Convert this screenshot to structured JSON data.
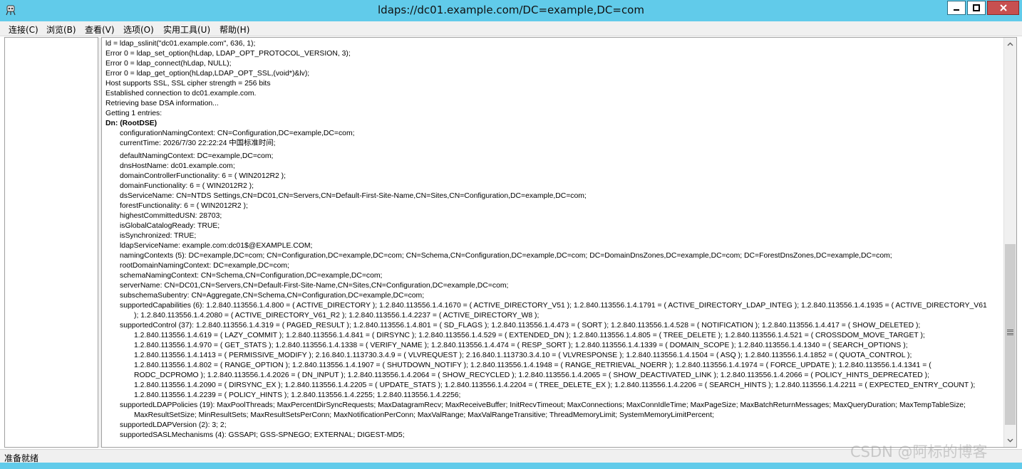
{
  "window": {
    "title": "ldaps://dc01.example.com/DC=example,DC=com",
    "icon": "ldp-app-icon"
  },
  "menu": [
    "连接(C)",
    "浏览(B)",
    "查看(V)",
    "选项(O)",
    "实用工具(U)",
    "帮助(H)"
  ],
  "log": {
    "lines": [
      "ld = ldap_sslinit(\"dc01.example.com\", 636, 1);",
      "Error 0 = ldap_set_option(hLdap, LDAP_OPT_PROTOCOL_VERSION, 3);",
      "Error 0 = ldap_connect(hLdap, NULL);",
      "Error 0 = ldap_get_option(hLdap,LDAP_OPT_SSL,(void*)&lv);",
      "Host supports SSL, SSL cipher strength = 256 bits",
      "Established connection to dc01.example.com.",
      "Retrieving base DSA information...",
      "Getting 1 entries:",
      "Dn: (RootDSE)",
      "configurationNamingContext: CN=Configuration,DC=example,DC=com;",
      "currentTime: 2026/7/30 22:22:24 中国标准时间;",
      "defaultNamingContext: DC=example,DC=com;",
      "dnsHostName: dc01.example.com;",
      "domainControllerFunctionality: 6 = ( WIN2012R2 );",
      "domainFunctionality: 6 = ( WIN2012R2 );",
      "dsServiceName: CN=NTDS Settings,CN=DC01,CN=Servers,CN=Default-First-Site-Name,CN=Sites,CN=Configuration,DC=example,DC=com;",
      "forestFunctionality: 6 = ( WIN2012R2 );",
      "highestCommittedUSN: 28703;",
      "isGlobalCatalogReady: TRUE;",
      "isSynchronized: TRUE;",
      "ldapServiceName: example.com:dc01$@EXAMPLE.COM;",
      "namingContexts (5): DC=example,DC=com; CN=Configuration,DC=example,DC=com; CN=Schema,CN=Configuration,DC=example,DC=com; DC=DomainDnsZones,DC=example,DC=com; DC=ForestDnsZones,DC=example,DC=com;",
      "rootDomainNamingContext: DC=example,DC=com;",
      "schemaNamingContext: CN=Schema,CN=Configuration,DC=example,DC=com;",
      "serverName: CN=DC01,CN=Servers,CN=Default-First-Site-Name,CN=Sites,CN=Configuration,DC=example,DC=com;",
      "subschemaSubentry: CN=Aggregate,CN=Schema,CN=Configuration,DC=example,DC=com;",
      "supportedCapabilities (6): 1.2.840.113556.1.4.800 = ( ACTIVE_DIRECTORY ); 1.2.840.113556.1.4.1670 = ( ACTIVE_DIRECTORY_V51 ); 1.2.840.113556.1.4.1791 = ( ACTIVE_DIRECTORY_LDAP_INTEG ); 1.2.840.113556.1.4.1935 = ( ACTIVE_DIRECTORY_V61",
      "); 1.2.840.113556.1.4.2080 = ( ACTIVE_DIRECTORY_V61_R2 ); 1.2.840.113556.1.4.2237 = ( ACTIVE_DIRECTORY_W8 );",
      "supportedControl (37): 1.2.840.113556.1.4.319 = ( PAGED_RESULT ); 1.2.840.113556.1.4.801 = ( SD_FLAGS ); 1.2.840.113556.1.4.473 = ( SORT ); 1.2.840.113556.1.4.528 = ( NOTIFICATION ); 1.2.840.113556.1.4.417 = ( SHOW_DELETED );",
      "1.2.840.113556.1.4.619 = ( LAZY_COMMIT ); 1.2.840.113556.1.4.841 = ( DIRSYNC ); 1.2.840.113556.1.4.529 = ( EXTENDED_DN ); 1.2.840.113556.1.4.805 = ( TREE_DELETE ); 1.2.840.113556.1.4.521 = ( CROSSDOM_MOVE_TARGET );",
      "1.2.840.113556.1.4.970 = ( GET_STATS ); 1.2.840.113556.1.4.1338 = ( VERIFY_NAME ); 1.2.840.113556.1.4.474 = ( RESP_SORT ); 1.2.840.113556.1.4.1339 = ( DOMAIN_SCOPE ); 1.2.840.113556.1.4.1340 = ( SEARCH_OPTIONS );",
      "1.2.840.113556.1.4.1413 = ( PERMISSIVE_MODIFY ); 2.16.840.1.113730.3.4.9 = ( VLVREQUEST ); 2.16.840.1.113730.3.4.10 = ( VLVRESPONSE ); 1.2.840.113556.1.4.1504 = ( ASQ ); 1.2.840.113556.1.4.1852 = ( QUOTA_CONTROL );",
      "1.2.840.113556.1.4.802 = ( RANGE_OPTION ); 1.2.840.113556.1.4.1907 = ( SHUTDOWN_NOTIFY ); 1.2.840.113556.1.4.1948 = ( RANGE_RETRIEVAL_NOERR ); 1.2.840.113556.1.4.1974 = ( FORCE_UPDATE ); 1.2.840.113556.1.4.1341 = (",
      "RODC_DCPROMO ); 1.2.840.113556.1.4.2026 = ( DN_INPUT ); 1.2.840.113556.1.4.2064 = ( SHOW_RECYCLED ); 1.2.840.113556.1.4.2065 = ( SHOW_DEACTIVATED_LINK ); 1.2.840.113556.1.4.2066 = ( POLICY_HINTS_DEPRECATED );",
      "1.2.840.113556.1.4.2090 = ( DIRSYNC_EX ); 1.2.840.113556.1.4.2205 = ( UPDATE_STATS ); 1.2.840.113556.1.4.2204 = ( TREE_DELETE_EX ); 1.2.840.113556.1.4.2206 = ( SEARCH_HINTS ); 1.2.840.113556.1.4.2211 = ( EXPECTED_ENTRY_COUNT );",
      "1.2.840.113556.1.4.2239 = ( POLICY_HINTS ); 1.2.840.113556.1.4.2255; 1.2.840.113556.1.4.2256;",
      "supportedLDAPPolicies (19): MaxPoolThreads; MaxPercentDirSyncRequests; MaxDatagramRecv; MaxReceiveBuffer; InitRecvTimeout; MaxConnections; MaxConnIdleTime; MaxPageSize; MaxBatchReturnMessages; MaxQueryDuration; MaxTempTableSize;",
      "MaxResultSetSize; MinResultSets; MaxResultSetsPerConn; MaxNotificationPerConn; MaxValRange; MaxValRangeTransitive; ThreadMemoryLimit; SystemMemoryLimitPercent;",
      "supportedLDAPVersion (2): 3; 2;",
      "supportedSASLMechanisms (4): GSSAPI; GSS-SPNEGO; EXTERNAL; DIGEST-MD5;"
    ]
  },
  "status": "准备就绪",
  "watermark": "CSDN @阿标的博客"
}
